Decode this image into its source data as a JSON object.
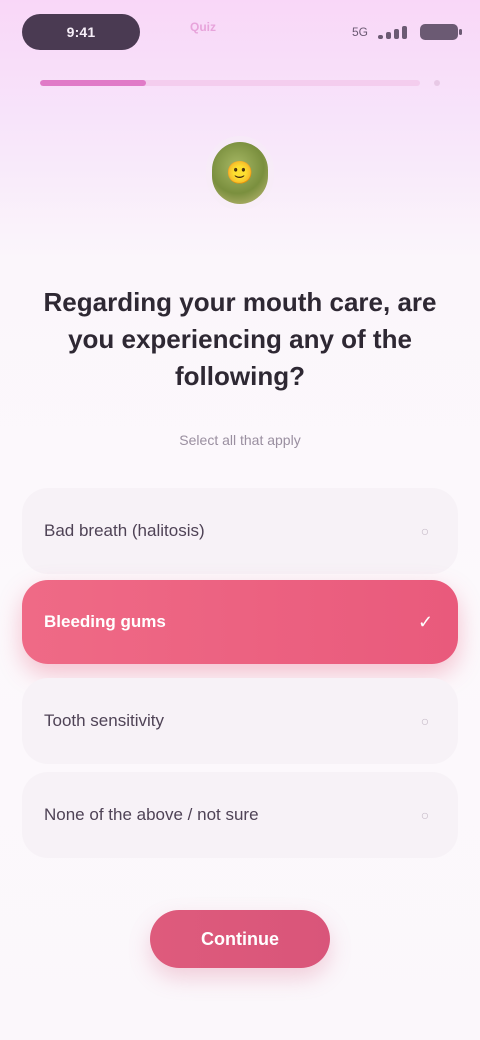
{
  "status_bar": {
    "time": "9:41",
    "carrier_text": "Quiz",
    "network": "5G"
  },
  "progress": {
    "value": 0.28
  },
  "avatar": {
    "emoji": "🙂"
  },
  "question": {
    "title": "Regarding your mouth care, are you experiencing any of the following?",
    "subtitle": "Select all that apply"
  },
  "options": [
    {
      "label": "Bad breath (halitosis)",
      "state": "default",
      "icon": "circle-icon"
    },
    {
      "label": "Bleeding gums",
      "state": "selected",
      "icon": "check-icon"
    },
    {
      "label": "Tooth sensitivity",
      "state": "default",
      "icon": "circle-icon"
    },
    {
      "label": "None of the above / not sure",
      "state": "default",
      "icon": "circle-icon"
    }
  ],
  "cta": {
    "label": "Continue"
  },
  "colors": {
    "accent": "#E95A7C",
    "background_top": "#F9D7F8",
    "background": "#FBF7FB"
  }
}
